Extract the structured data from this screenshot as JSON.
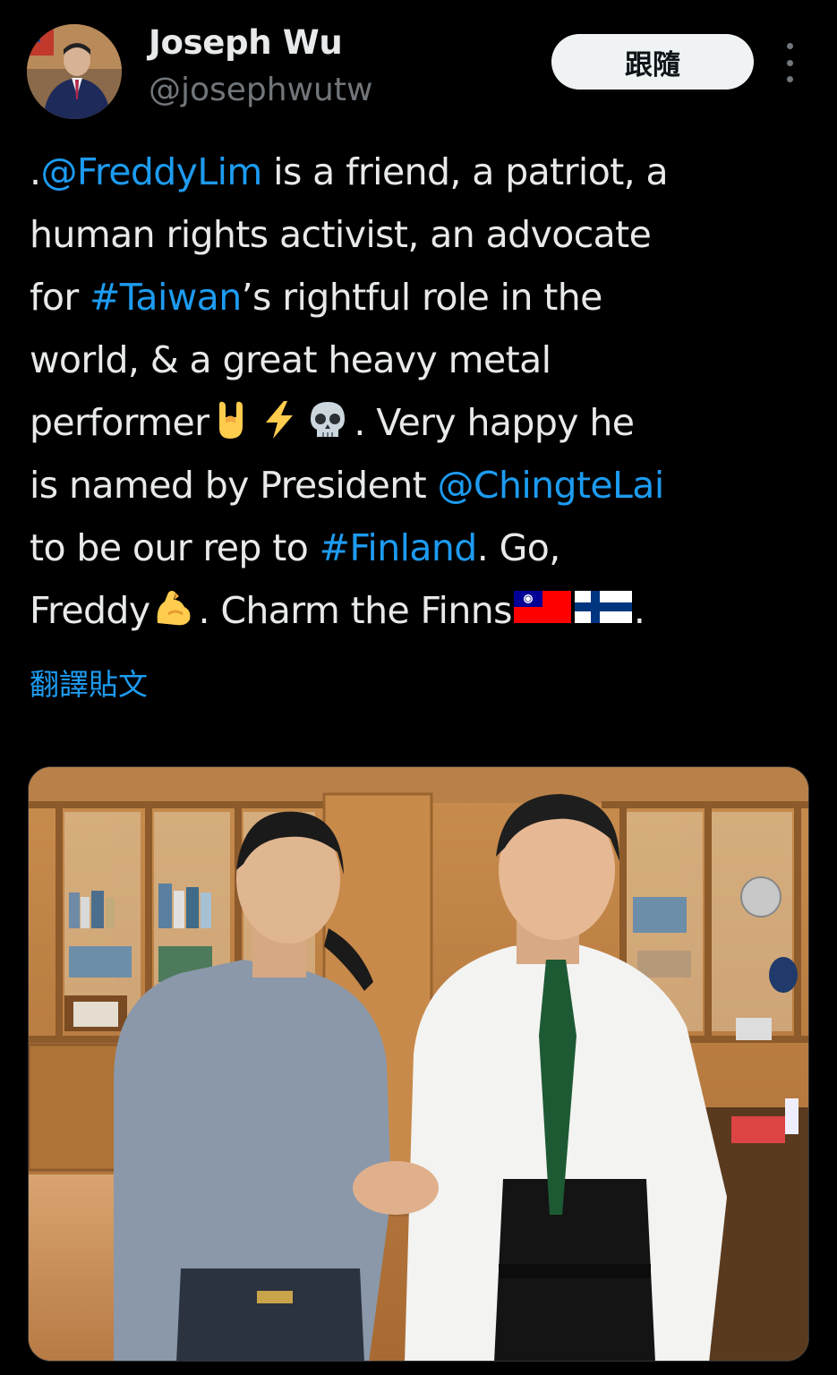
{
  "author": {
    "name": "Joseph Wu",
    "handle": "@josephwutw",
    "avatar_icon": "profile-photo"
  },
  "actions": {
    "follow_label": "跟隨",
    "more_icon": "more-vertical-icon"
  },
  "tweet": {
    "lines": [
      [
        {
          "t": ".",
          "k": "text"
        },
        {
          "t": "@FreddyLim",
          "k": "link"
        },
        {
          "t": " is a friend, a patriot, a",
          "k": "text"
        }
      ],
      [
        {
          "t": "human rights activist, an advocate",
          "k": "text"
        }
      ],
      [
        {
          "t": "for ",
          "k": "text"
        },
        {
          "t": "#Taiwan",
          "k": "link"
        },
        {
          "t": "’s rightful role in the",
          "k": "text"
        }
      ],
      [
        {
          "t": "world, & a great heavy metal",
          "k": "text"
        }
      ],
      [
        {
          "t": "performer",
          "k": "text"
        },
        {
          "t": "horns",
          "k": "emoji"
        },
        {
          "t": "bolt",
          "k": "emoji"
        },
        {
          "t": "skull",
          "k": "emoji"
        },
        {
          "t": ". Very happy he",
          "k": "text"
        }
      ],
      [
        {
          "t": "is named by President ",
          "k": "text"
        },
        {
          "t": "@ChingteLai",
          "k": "link"
        }
      ],
      [
        {
          "t": "to be our rep to ",
          "k": "text"
        },
        {
          "t": "#Finland",
          "k": "link"
        },
        {
          "t": ". Go,",
          "k": "text"
        }
      ],
      [
        {
          "t": "Freddy",
          "k": "text"
        },
        {
          "t": "muscle",
          "k": "emoji"
        },
        {
          "t": ". Charm the Finns",
          "k": "text"
        },
        {
          "t": "taiwan",
          "k": "flag"
        },
        {
          "t": "finland",
          "k": "flag"
        },
        {
          "t": ".",
          "k": "text"
        }
      ]
    ],
    "translate_label": "翻譯貼文"
  },
  "media": {
    "type": "photo",
    "description_icon": "photo-two-men-handshake"
  },
  "colors": {
    "background": "#000000",
    "text": "#e7e9ea",
    "secondary": "#71767b",
    "link": "#1d9bf0",
    "follow_bg": "#eff3f4"
  }
}
